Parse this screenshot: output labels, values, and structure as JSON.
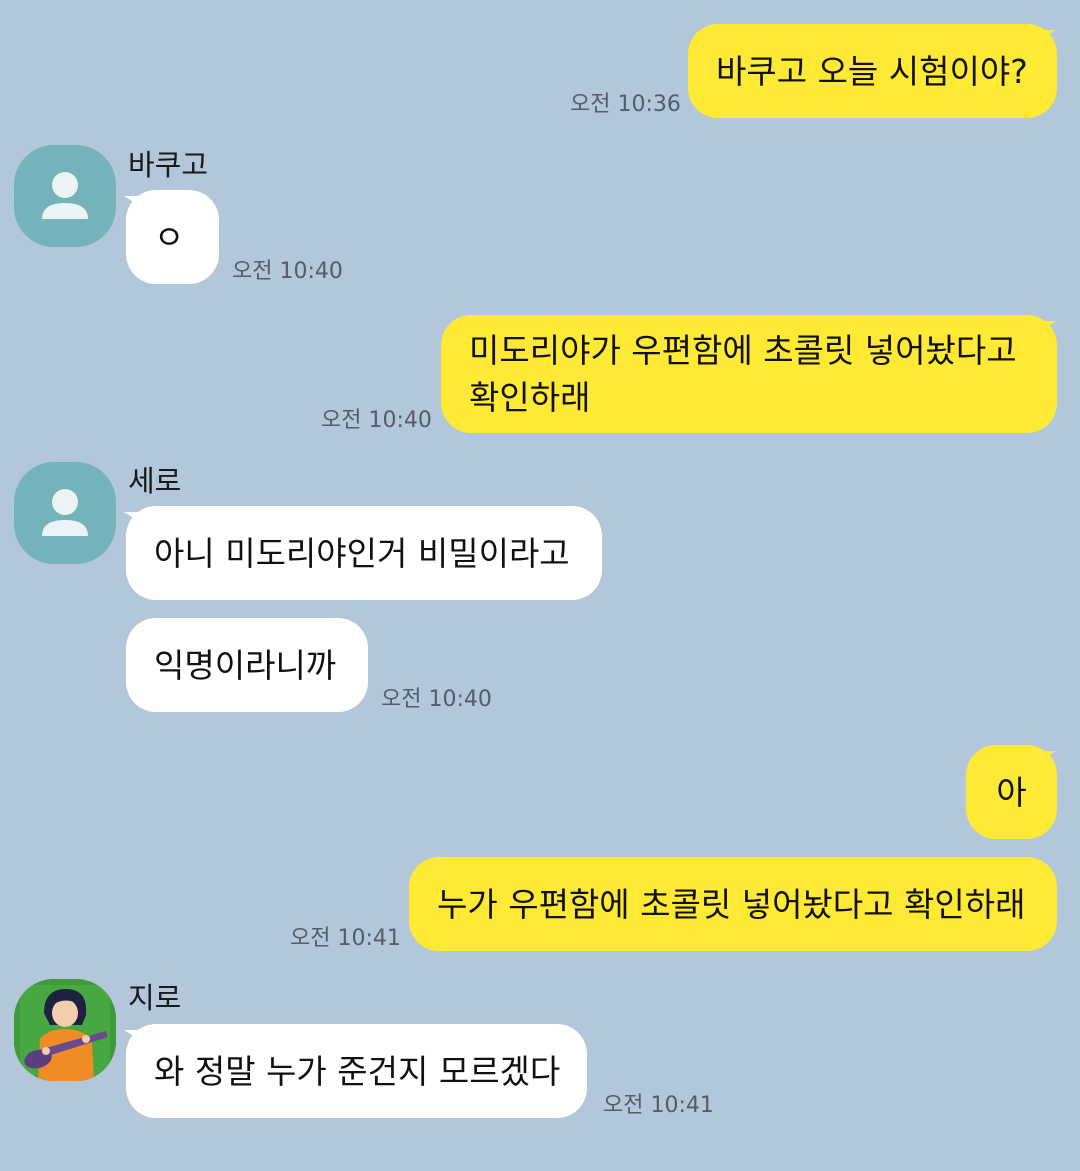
{
  "messages": {
    "m1": {
      "text": "바쿠고 오늘 시험이야?",
      "time": "오전 10:36"
    },
    "m2": {
      "sender": "바쿠고",
      "text": "ㅇ",
      "time": "오전 10:40"
    },
    "m3": {
      "line1": "미도리야가 우편함에 초콜릿 넣어놨다고",
      "line2": "확인하래",
      "time": "오전 10:40"
    },
    "m4": {
      "sender": "세로",
      "text": "아니 미도리야인거 비밀이라고"
    },
    "m5": {
      "text": "익명이라니까",
      "time": "오전 10:40"
    },
    "m6": {
      "text": "아"
    },
    "m7": {
      "text": "누가 우편함에 초콜릿 넣어놨다고 확인하래",
      "time": "오전 10:41"
    },
    "m8": {
      "sender": "지로",
      "text": "와 정말 누가 준건지 모르겠다",
      "time": "오전 10:41"
    }
  },
  "colors": {
    "background": "#b2c7da",
    "my_bubble": "#fee934",
    "their_bubble": "#ffffff",
    "default_avatar": "#75b3bb"
  },
  "icons": {
    "default_avatar": "person-icon",
    "custom_avatar": "girl-with-guitar-icon"
  }
}
